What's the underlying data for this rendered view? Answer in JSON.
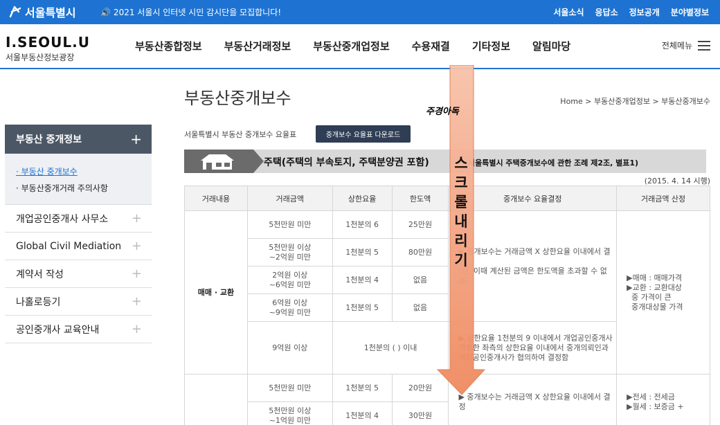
{
  "topbar": {
    "logo": "서울특별시",
    "notice": "2021 서울시 인터넷 시민 감시단을 모집합니다!",
    "links": [
      "서울소식",
      "응답소",
      "정보공개",
      "분야별정보"
    ]
  },
  "header": {
    "brand_title": "I.SEOUL.U",
    "brand_sub": "서울부동산정보광장",
    "nav": [
      "부동산종합정보",
      "부동산거래정보",
      "부동산중개업정보",
      "수용재결",
      "기타정보",
      "알림마당"
    ],
    "allmenu": "전체메뉴"
  },
  "sidebar": {
    "head": "부동산 중개정보",
    "sub": [
      "· 부동산 중개보수",
      "· 부동산중개거래 주의사항"
    ],
    "items": [
      "개업공인중개사 사무소",
      "Global Civil Mediation",
      "계약서 작성",
      "나홀로등기",
      "공인중개사 교육안내"
    ]
  },
  "page": {
    "title": "부동산중개보수",
    "breadcrumb": "Home  >  부동산중개업정보  >  부동산중개보수",
    "desc": "서울특별시 부동산 중개보수 요율표",
    "download": "중개보수 요율표 다운로드",
    "category": "주택(주택의 부속토지, 주택분양권 포함)",
    "law": "서울특별시 주택중개보수에 관한 조례 제2조, 별표1)",
    "date_note": "(2015. 4. 14 시행)"
  },
  "table": {
    "headers": [
      "거래내용",
      "거래금액",
      "상한요율",
      "한도액",
      "중개보수 요율결정",
      "거래금액 산정"
    ],
    "sale_label": "매매 · 교환",
    "sale_rows": [
      [
        "5천만원 미만",
        "1천분의 6",
        "25만원"
      ],
      [
        "5천만원 이상\n~2억원 미만",
        "1천분의 5",
        "80만원"
      ],
      [
        "2억원 이상\n~6억원 미만",
        "1천분의 4",
        "없음"
      ],
      [
        "6억원 이상\n~9억원 미만",
        "1천분의 5",
        "없음"
      ],
      [
        "9억원 이상",
        "1천분의 ( ) 이내",
        ""
      ]
    ],
    "sale_decision1": "▶ 중개보수는 거래금액 X 상한요율 이내에서 결정\n(단, 이때 계산된 금액은 한도액을 초과할 수 없음)",
    "sale_decision2": "▶ 상한요율 1천분의 9 이내에서 개업공인중개사가정한 좌측의 상한요율 이내에서 중개의뢰인과 개업공인중개사가 협의하여 결정함",
    "sale_calc": "▶매매 : 매매가격\n▶교환 : 교환대상\n  중 가격이 큰\n  중개대상물 가격",
    "lease_rows": [
      [
        "5천만원 미만",
        "1천분의 5",
        "20만원"
      ],
      [
        "5천만원 이상\n~1억원 미만",
        "1천분의 4",
        "30만원"
      ]
    ],
    "lease_decision": "▶ 중개보수는 거래금액 X 상한요율 이내에서 결정",
    "lease_calc": "▶전세 : 전세금\n▶월세 : 보증금 +"
  },
  "overlay": {
    "annotation": "주경아독",
    "scroll_text": "스크롤 내리기",
    "arrow_color": "#f4a27c"
  }
}
